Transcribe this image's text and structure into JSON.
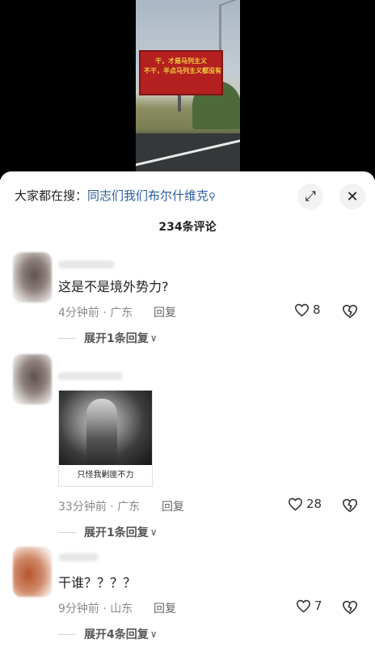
{
  "video": {
    "billboard_lines": [
      "干，才是马列主义",
      "不干，半点马列主义都没有"
    ]
  },
  "sheet": {
    "search_prefix": "大家都在搜：",
    "search_query": "同志们我们布尔什维克",
    "search_icon": "search-icon",
    "expand_icon": "expand-icon",
    "close_icon": "close-icon",
    "comment_count": "234条评论"
  },
  "comments": [
    {
      "text": "这是不是境外势力?",
      "meta": "4分钟前 · 广东",
      "reply_label": "回复",
      "likes": "8",
      "expand_label": "展开1条回复"
    },
    {
      "image_caption": "只怪我剿匪不力",
      "meta": "33分钟前 · 广东",
      "reply_label": "回复",
      "likes": "28",
      "expand_label": "展开1条回复"
    },
    {
      "text": "干谁？？？？",
      "meta": "9分钟前 · 山东",
      "reply_label": "回复",
      "likes": "7",
      "expand_label": "展开4条回复"
    }
  ]
}
